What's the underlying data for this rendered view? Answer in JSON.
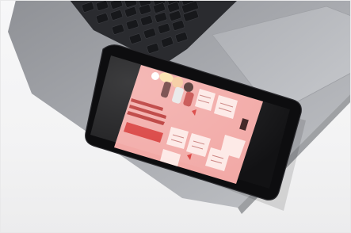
{
  "scene": {
    "description_visible": "",
    "colors": {
      "background": "#f4f4f5",
      "laptop_body": "#a9abb0",
      "keyboard": "#1f2023",
      "trackpad": "#b4b6bb",
      "phone_bezel": "#0d0d0f",
      "flyer_pink": "#f2a9a6",
      "flyer_red_banner": "#d83c3a",
      "flyer_card": "#fde9e6"
    },
    "icons": [
      "laptop-keyboard",
      "smartphone",
      "infographic-flyer"
    ]
  }
}
